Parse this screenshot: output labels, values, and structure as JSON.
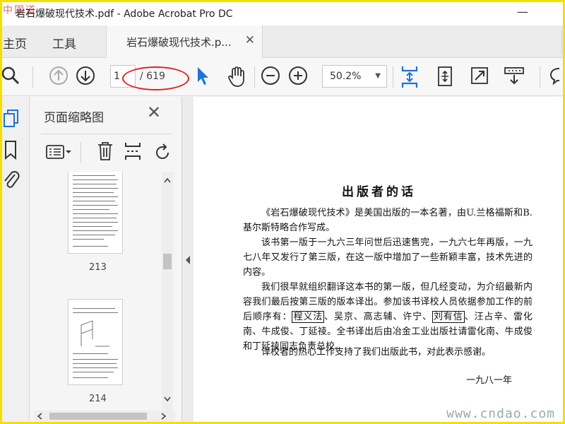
{
  "window": {
    "watermark": "中国道",
    "title": "岩石爆破现代技术.pdf - Adobe Acrobat Pro DC",
    "minimize": "—"
  },
  "nav": {
    "home": "主页",
    "tools": "工具",
    "tab_label": "岩石爆破现代技术.p...",
    "tab_close": "✕"
  },
  "toolbar": {
    "page_current": "1",
    "page_total": "/ 619",
    "zoom": "50.2%",
    "zoom_caret": "▼"
  },
  "thumbnails": {
    "title": "页面缩略图",
    "close": "✕",
    "pages": [
      "213",
      "214"
    ]
  },
  "document": {
    "heading": "出版者的话",
    "p1_pre": "《岩石爆破现代技术》是美国出版的一本名著，由U.兰格福斯和B.基尔斯特略合作写成。",
    "p2": "该书第一版于一九六三年问世后迅速售完，一九六七年再版，一九七八年又发行了第三版，在这一版中增加了一些新颖丰富，技术先进的内容。",
    "p3_a": "我们很早就组织翻译这本书的第一版，但几经变动，为介绍最新内容我们最后按第三版的版本译出。参加该书译校人员依据参加工作的前后顺序有：",
    "name1": "程义法",
    "p3_b": "、吴京、高志辅、许宁、",
    "name2": "刘有信",
    "p3_c": "、汪占辛、雷化南、牛成俊、丁延祾。全书译出后由冶金工业出版社请雷化南、牛成俊和丁延祾同志负责总校。",
    "p4": "译校者的热心工作支持了我们出版此书，对此表示感谢。",
    "date": "一九八一年"
  },
  "site_watermark": "www.cndao.com",
  "colors": {
    "frame": "#f3e000",
    "accent_blue": "#1e73d6",
    "annotation_red": "#e22222"
  }
}
